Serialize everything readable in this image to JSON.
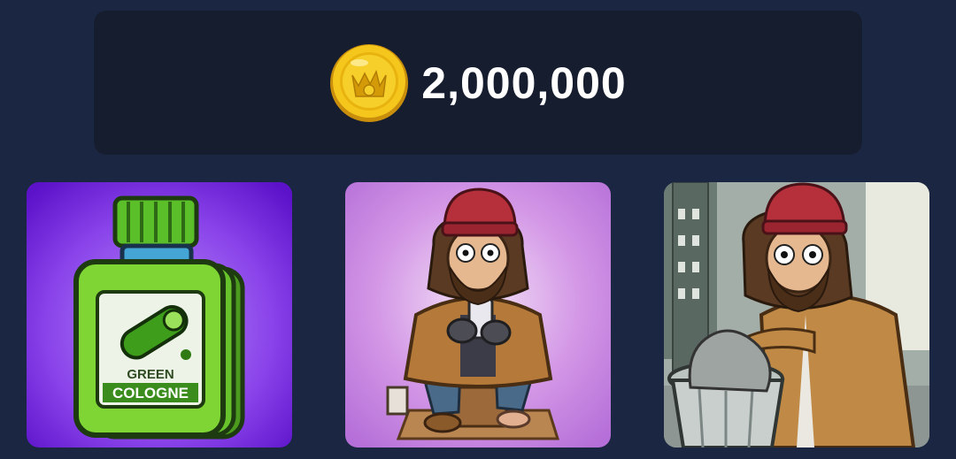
{
  "balance": {
    "amount": "2,000,000",
    "currency_icon": "gold-coin-icon"
  },
  "cards": [
    {
      "id": "green-cologne",
      "label_line1": "GREEN",
      "label_line2": "COLOGNE",
      "bg": "#7a2ee0"
    },
    {
      "id": "homeless-phone",
      "bg": "#c984e6"
    },
    {
      "id": "homeless-trash",
      "bg": "#7f8a86"
    }
  ],
  "colors": {
    "page_bg": "#1b2742",
    "panel_bg": "#161d2f",
    "coin_gold": "#f2c21a",
    "text": "#ffffff"
  }
}
